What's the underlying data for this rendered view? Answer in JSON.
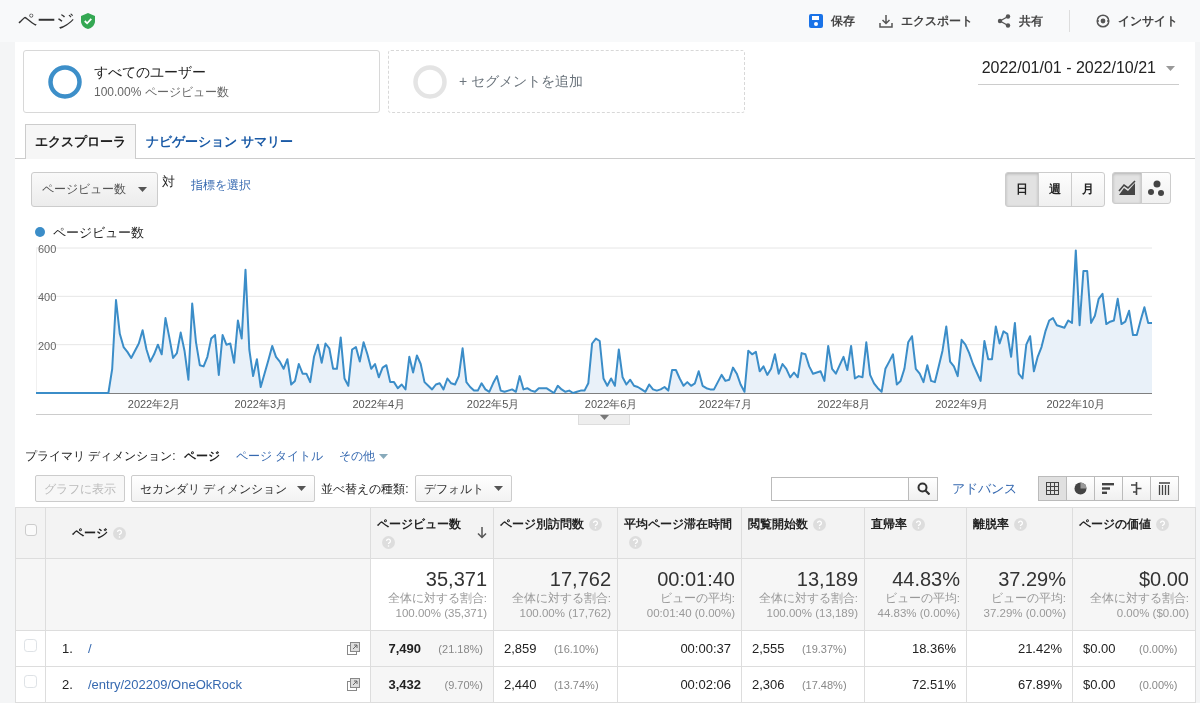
{
  "header": {
    "title": "ページ",
    "actions": [
      {
        "kind": "save",
        "label": "保存"
      },
      {
        "kind": "export",
        "label": "エクスポート"
      },
      {
        "kind": "share",
        "label": "共有"
      },
      {
        "kind": "insight",
        "label": "インサイト"
      }
    ]
  },
  "segments": [
    {
      "kind": "segment",
      "title": "すべてのユーザー",
      "subtitle": "100.00% ページビュー数"
    },
    {
      "kind": "add",
      "title": "+ セグメントを追加"
    }
  ],
  "date_range": "2022/01/01 - 2022/10/21",
  "tabs": [
    {
      "label": "エクスプローラ",
      "selected": true
    },
    {
      "label": "ナビゲーション サマリー",
      "selected": false
    }
  ],
  "metric_select": "ページビュー数",
  "versus": "対",
  "metric_link": "指標を選択",
  "period_buttons": [
    {
      "label": "日",
      "selected": true
    },
    {
      "label": "週",
      "selected": false
    },
    {
      "label": "月",
      "selected": false
    }
  ],
  "chart_types": [
    {
      "kind": "line",
      "selected": true
    },
    {
      "kind": "bubble",
      "selected": false
    }
  ],
  "chart": {
    "chart_data": {
      "type": "area",
      "ylim": [
        0,
        600
      ],
      "yticks": [
        200,
        400,
        600
      ],
      "categories": [
        null,
        null,
        null,
        null,
        null,
        null,
        null,
        null,
        null,
        null,
        null,
        null,
        null,
        null,
        null,
        null,
        null,
        null,
        null,
        null,
        null,
        null,
        null,
        null,
        null,
        null,
        null,
        null,
        null,
        null,
        null,
        "2022年2月",
        null,
        null,
        null,
        null,
        null,
        null,
        null,
        null,
        null,
        null,
        null,
        null,
        null,
        null,
        null,
        null,
        null,
        null,
        null,
        null,
        null,
        null,
        null,
        null,
        null,
        null,
        null,
        "2022年3月",
        null,
        null,
        null,
        null,
        null,
        null,
        null,
        null,
        null,
        null,
        null,
        null,
        null,
        null,
        null,
        null,
        null,
        null,
        null,
        null,
        null,
        null,
        null,
        null,
        null,
        null,
        null,
        null,
        null,
        null,
        "2022年4月",
        null,
        null,
        null,
        null,
        null,
        null,
        null,
        null,
        null,
        null,
        null,
        null,
        null,
        null,
        null,
        null,
        null,
        null,
        null,
        null,
        null,
        null,
        null,
        null,
        null,
        null,
        null,
        null,
        null,
        "2022年5月",
        null,
        null,
        null,
        null,
        null,
        null,
        null,
        null,
        null,
        null,
        null,
        null,
        null,
        null,
        null,
        null,
        null,
        null,
        null,
        null,
        null,
        null,
        null,
        null,
        null,
        null,
        null,
        null,
        null,
        null,
        "2022年6月",
        null,
        null,
        null,
        null,
        null,
        null,
        null,
        null,
        null,
        null,
        null,
        null,
        null,
        null,
        null,
        null,
        null,
        null,
        null,
        null,
        null,
        null,
        null,
        null,
        null,
        null,
        null,
        null,
        null,
        "2022年7月",
        null,
        null,
        null,
        null,
        null,
        null,
        null,
        null,
        null,
        null,
        null,
        null,
        null,
        null,
        null,
        null,
        null,
        null,
        null,
        null,
        null,
        null,
        null,
        null,
        null,
        null,
        null,
        null,
        null,
        null,
        "2022年8月",
        null,
        null,
        null,
        null,
        null,
        null,
        null,
        null,
        null,
        null,
        null,
        null,
        null,
        null,
        null,
        null,
        null,
        null,
        null,
        null,
        null,
        null,
        null,
        null,
        null,
        null,
        null,
        null,
        null,
        null,
        "2022年9月",
        null,
        null,
        null,
        null,
        null,
        null,
        null,
        null,
        null,
        null,
        null,
        null,
        null,
        null,
        null,
        null,
        null,
        null,
        null,
        null,
        null,
        null,
        null,
        null,
        null,
        null,
        null,
        null,
        null,
        "2022年10月",
        null,
        null,
        null,
        null,
        null,
        null,
        null,
        null,
        null,
        null,
        null,
        null,
        null,
        null,
        null,
        null,
        null,
        null,
        null,
        null
      ],
      "series": [
        {
          "name": "ページビュー数",
          "color": "#3b8dc8",
          "values": [
            0,
            0,
            0,
            0,
            0,
            0,
            0,
            0,
            0,
            0,
            0,
            0,
            0,
            0,
            0,
            0,
            0,
            0,
            0,
            0,
            100,
            385,
            245,
            190,
            170,
            145,
            175,
            205,
            260,
            180,
            130,
            160,
            200,
            160,
            310,
            230,
            145,
            165,
            250,
            175,
            55,
            370,
            210,
            115,
            110,
            150,
            225,
            240,
            75,
            240,
            200,
            205,
            125,
            300,
            225,
            510,
            180,
            70,
            140,
            25,
            80,
            135,
            195,
            150,
            130,
            100,
            140,
            35,
            50,
            120,
            80,
            80,
            45,
            150,
            200,
            125,
            205,
            185,
            100,
            100,
            230,
            60,
            30,
            180,
            190,
            130,
            210,
            160,
            100,
            120,
            65,
            105,
            115,
            45,
            45,
            20,
            35,
            15,
            150,
            85,
            155,
            120,
            45,
            30,
            15,
            35,
            40,
            15,
            60,
            40,
            35,
            70,
            185,
            45,
            25,
            10,
            10,
            40,
            15,
            5,
            40,
            70,
            10,
            5,
            10,
            15,
            5,
            70,
            15,
            20,
            10,
            5,
            20,
            20,
            20,
            10,
            0,
            30,
            15,
            5,
            10,
            0,
            5,
            10,
            10,
            40,
            205,
            225,
            215,
            60,
            30,
            60,
            30,
            180,
            65,
            35,
            55,
            30,
            25,
            15,
            5,
            35,
            15,
            10,
            15,
            25,
            10,
            95,
            95,
            60,
            30,
            45,
            30,
            40,
            90,
            30,
            20,
            15,
            15,
            45,
            75,
            50,
            55,
            105,
            80,
            35,
            5,
            175,
            160,
            170,
            90,
            110,
            75,
            100,
            160,
            80,
            120,
            100,
            65,
            85,
            65,
            165,
            160,
            110,
            80,
            85,
            90,
            50,
            195,
            100,
            80,
            115,
            150,
            95,
            195,
            60,
            70,
            65,
            210,
            75,
            40,
            20,
            5,
            100,
            130,
            160,
            35,
            50,
            100,
            210,
            235,
            100,
            80,
            45,
            115,
            50,
            45,
            110,
            175,
            275,
            130,
            110,
            70,
            220,
            200,
            165,
            120,
            85,
            50,
            215,
            140,
            140,
            275,
            205,
            255,
            245,
            150,
            290,
            80,
            60,
            200,
            235,
            90,
            150,
            190,
            255,
            300,
            310,
            280,
            275,
            270,
            300,
            290,
            590,
            280,
            505,
            505,
            290,
            320,
            390,
            410,
            285,
            295,
            300,
            390,
            285,
            295,
            340,
            240,
            240,
            300,
            355,
            290,
            290
          ]
        }
      ]
    }
  },
  "primary_dimension": {
    "label": "プライマリ ディメンション:",
    "options": [
      {
        "label": "ページ",
        "selected": true
      },
      {
        "label": "ページ タイトル",
        "selected": false
      }
    ],
    "more": "その他"
  },
  "toolbar": {
    "plot_button": {
      "label": "グラフに表示",
      "disabled": true
    },
    "secondary_dimension": "セカンダリ ディメンション",
    "sort_label": "並べ替えの種類:",
    "sort_value": "デフォルト",
    "advanced_link": "アドバンス",
    "views": [
      {
        "kind": "table",
        "selected": true
      },
      {
        "kind": "pie",
        "selected": false
      },
      {
        "kind": "performance",
        "selected": false
      },
      {
        "kind": "comparison",
        "selected": false
      },
      {
        "kind": "pivot",
        "selected": false
      }
    ]
  },
  "table": {
    "select_all": {
      "checked": false
    },
    "page_column": {
      "label": "ページ"
    },
    "columns": [
      {
        "label": "ページビュー数",
        "sorted": true
      },
      {
        "label": "ページ別訪問数",
        "sorted": false
      },
      {
        "label": "平均ページ滞在時間",
        "sorted": false
      },
      {
        "label": "閲覧開始数",
        "sorted": false
      },
      {
        "label": "直帰率",
        "sorted": false
      },
      {
        "label": "離脱率",
        "sorted": false
      },
      {
        "label": "ページの価値",
        "sorted": false
      }
    ],
    "totals": [
      {
        "value": "35,371",
        "note": "全体に対する割合:",
        "detail": "100.00% (35,371)"
      },
      {
        "value": "17,762",
        "note": "全体に対する割合:",
        "detail": "100.00% (17,762)"
      },
      {
        "value": "00:01:40",
        "note": "ビューの平均:",
        "detail": "00:01:40 (0.00%)"
      },
      {
        "value": "13,189",
        "note": "全体に対する割合:",
        "detail": "100.00% (13,189)"
      },
      {
        "value": "44.83%",
        "note": "ビューの平均:",
        "detail": "44.83% (0.00%)"
      },
      {
        "value": "37.29%",
        "note": "ビューの平均:",
        "detail": "37.29% (0.00%)"
      },
      {
        "value": "$0.00",
        "note": "全体に対する割合:",
        "detail": "0.00% ($0.00)"
      }
    ],
    "rows": [
      {
        "checked": false,
        "index": "1.",
        "page": "/",
        "cells": [
          {
            "value": "7,490",
            "pct": "(21.18%)"
          },
          {
            "value": "2,859",
            "pct": "(16.10%)"
          },
          {
            "value": "00:00:37"
          },
          {
            "value": "2,555",
            "pct": "(19.37%)"
          },
          {
            "value": "18.36%"
          },
          {
            "value": "21.42%"
          },
          {
            "value": "$0.00",
            "pct": "(0.00%)"
          }
        ]
      },
      {
        "checked": false,
        "index": "2.",
        "page": "/entry/202209/OneOkRock",
        "cells": [
          {
            "value": "3,432",
            "pct": "(9.70%)"
          },
          {
            "value": "2,440",
            "pct": "(13.74%)"
          },
          {
            "value": "00:02:06"
          },
          {
            "value": "2,306",
            "pct": "(17.48%)"
          },
          {
            "value": "72.51%"
          },
          {
            "value": "67.89%"
          },
          {
            "value": "$0.00",
            "pct": "(0.00%)"
          }
        ]
      }
    ]
  }
}
